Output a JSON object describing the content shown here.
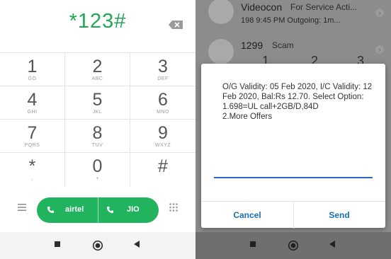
{
  "dialer": {
    "number": "*123#",
    "keys": [
      {
        "digit": "1",
        "letters": "GO"
      },
      {
        "digit": "2",
        "letters": "ABC"
      },
      {
        "digit": "3",
        "letters": "DEF"
      },
      {
        "digit": "4",
        "letters": "GHI"
      },
      {
        "digit": "5",
        "letters": "JKL"
      },
      {
        "digit": "6",
        "letters": "MNO"
      },
      {
        "digit": "7",
        "letters": "PQRS"
      },
      {
        "digit": "8",
        "letters": "TUV"
      },
      {
        "digit": "9",
        "letters": "WXYZ"
      },
      {
        "digit": "*",
        "letters": ","
      },
      {
        "digit": "0",
        "letters": "+"
      },
      {
        "digit": "#",
        "letters": ""
      }
    ],
    "sim1_label": "airtel",
    "sim2_label": "JIO",
    "accent": "#22b35e"
  },
  "call_log": {
    "row1_title": "Videocon",
    "row1_tag": "For Service Acti...",
    "row1_sub": "198 9:45 PM Outgoing: 1m...",
    "row2_title": "1299",
    "row2_tag": "Scam",
    "peek": [
      "1",
      "2",
      "3"
    ]
  },
  "ussd_dialog": {
    "message": "O/G Validity: 05 Feb 2020, I/C Validity: 12 Feb 2020, Bal:Rs 12.70. Select Option:",
    "option1": "1.698=UL call+2GB/D,84D",
    "option2": "2.More Offers",
    "input_value": "",
    "cancel_label": "Cancel",
    "send_label": "Send",
    "accent": "#1a6fb5"
  },
  "icons": {
    "backspace": "backspace-icon",
    "menu": "menu-icon",
    "dialpad": "dialpad-icon",
    "phone": "phone-icon",
    "nav_recents": "square-icon",
    "nav_home": "circle-icon",
    "nav_back": "triangle-back-icon"
  }
}
